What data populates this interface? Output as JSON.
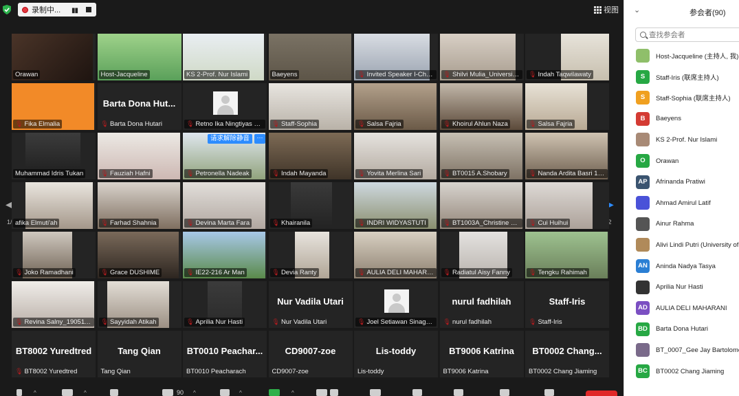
{
  "topbar": {
    "recording_label": "录制中...",
    "pause_glyph": "▮▮",
    "view_label": "视图"
  },
  "gallery": {
    "page_indicator_left": "1/2",
    "page_indicator_right": "1/2",
    "unmute_request": "请求解除静音",
    "more_glyph": "···",
    "tiles": [
      {
        "name": "Orawan",
        "muted": false
      },
      {
        "name": "Host-Jacqueline",
        "muted": false
      },
      {
        "name": "KS 2-Prof. Nur Islami",
        "muted": false
      },
      {
        "name": "Baeyens",
        "muted": false
      },
      {
        "name": "Invited Speaker I-Chun...",
        "muted": true
      },
      {
        "name": "Shilvi Mulia_University...",
        "muted": true
      },
      {
        "name": "Indah Taqwilawaty",
        "muted": true
      },
      {
        "name": "Fika Elmalia",
        "muted": true
      },
      {
        "name": "Barta Dona Hutari",
        "big": "Barta Dona Hut...",
        "muted": true
      },
      {
        "name": "Retno Ika Ningtiyas 19...",
        "muted": true
      },
      {
        "name": "Staff-Sophia",
        "muted": true
      },
      {
        "name": "Salsa Fajria",
        "muted": true
      },
      {
        "name": "Khoirul Ahlun Naza",
        "muted": true
      },
      {
        "name": "Salsa Fajria",
        "muted": true
      },
      {
        "name": "Muhammad Idris Tukan",
        "muted": false
      },
      {
        "name": "Fauziah Hafni",
        "muted": true
      },
      {
        "name": "Petronella Nadeak",
        "muted": true
      },
      {
        "name": "Indah Mayanda",
        "muted": true
      },
      {
        "name": "Yovita Merlina Sari",
        "muted": true
      },
      {
        "name": "BT0015 A.Shobary",
        "muted": true
      },
      {
        "name": "Nanda Ardita Basri 19...",
        "muted": true
      },
      {
        "name": "afika Elmuti'ah",
        "muted": false
      },
      {
        "name": "Farhad Shahnia",
        "muted": true
      },
      {
        "name": "Devina Marta Fara",
        "muted": true
      },
      {
        "name": "Khairanila",
        "muted": true
      },
      {
        "name": "INDRI WIDYASTUTI",
        "muted": true
      },
      {
        "name": "BT1003A_Christine Ma...",
        "muted": true
      },
      {
        "name": "Cui Huihui",
        "muted": true
      },
      {
        "name": "Joko Ramadhani",
        "muted": true
      },
      {
        "name": "Grace DUSHIME",
        "muted": true
      },
      {
        "name": "IE22-216 Ar Man",
        "muted": true
      },
      {
        "name": "Devia Ranty",
        "muted": true
      },
      {
        "name": "AULIA DELI MAHARANI",
        "muted": true
      },
      {
        "name": "Radiatul Aisy Fanny",
        "muted": true
      },
      {
        "name": "Tengku Rahimah",
        "muted": true
      },
      {
        "name": "Revina Salny_1905111...",
        "muted": true
      },
      {
        "name": "Sayyidah Atikah",
        "muted": true
      },
      {
        "name": "Aprilia Nur Hasti",
        "muted": true
      },
      {
        "name": "Nur Vadila Utari",
        "big": "Nur Vadila Utari",
        "muted": true
      },
      {
        "name": "Joel Setiawan Sinaga 1...",
        "muted": true
      },
      {
        "name": "nurul fadhilah",
        "big": "nurul fadhilah",
        "muted": true
      },
      {
        "name": "Staff-Iris",
        "big": "Staff-Iris",
        "muted": true
      },
      {
        "name": "BT8002 Yuredtred",
        "big": "BT8002 Yuredtred",
        "muted": true
      },
      {
        "name": "Tang Qian",
        "big": "Tang Qian",
        "muted": false
      },
      {
        "name": "BT0010 Peacharach",
        "big": "BT0010 Peachar...",
        "muted": false
      },
      {
        "name": "CD9007-zoe",
        "big": "CD9007-zoe",
        "muted": false
      },
      {
        "name": "Lis-toddy",
        "big": "Lis-toddy",
        "muted": false
      },
      {
        "name": "BT9006 Katrina",
        "big": "BT9006 Katrina",
        "muted": false
      },
      {
        "name": "BT0002 Chang Jiaming",
        "big": "BT0002 Chang...",
        "muted": false
      }
    ]
  },
  "toolbar": {
    "participant_count": "90"
  },
  "panel": {
    "title": "参会者(90)",
    "search_placeholder": "查找参会者",
    "participants": [
      {
        "initials": "",
        "name": "Host-Jacqueline (主持人, 我)",
        "color": "#8fbf6a"
      },
      {
        "initials": "S",
        "name": "Staff-Iris (联席主持人)",
        "color": "#27a844"
      },
      {
        "initials": "S",
        "name": "Staff-Sophia (联席主持人)",
        "color": "#f0a020"
      },
      {
        "initials": "B",
        "name": "Baeyens",
        "color": "#d43b33"
      },
      {
        "initials": "",
        "name": "KS 2-Prof. Nur Islami",
        "color": "#a88a76"
      },
      {
        "initials": "O",
        "name": "Orawan",
        "color": "#27a844"
      },
      {
        "initials": "AP",
        "name": "Afrinanda Pratiwi",
        "color": "#3b5470"
      },
      {
        "initials": "",
        "name": "Ahmad Amirul Latif",
        "color": "#4a52d8"
      },
      {
        "initials": "",
        "name": "Ainur Rahma",
        "color": "#555555"
      },
      {
        "initials": "",
        "name": "Alivi Lindi Putri (University of",
        "color": "#b08a5a"
      },
      {
        "initials": "AN",
        "name": "Aninda Nadya Tasya",
        "color": "#2b7fd4"
      },
      {
        "initials": "",
        "name": "Aprilia Nur Hasti",
        "color": "#333333"
      },
      {
        "initials": "AD",
        "name": "AULIA DELI MAHARANI",
        "color": "#7b4fc2"
      },
      {
        "initials": "BD",
        "name": "Barta Dona Hutari",
        "color": "#27a844"
      },
      {
        "initials": "",
        "name": "BT_0007_Gee Jay Bartolome",
        "color": "#7a6a8a"
      },
      {
        "initials": "BC",
        "name": "BT0002  Chang Jiaming",
        "color": "#27a844"
      }
    ]
  }
}
